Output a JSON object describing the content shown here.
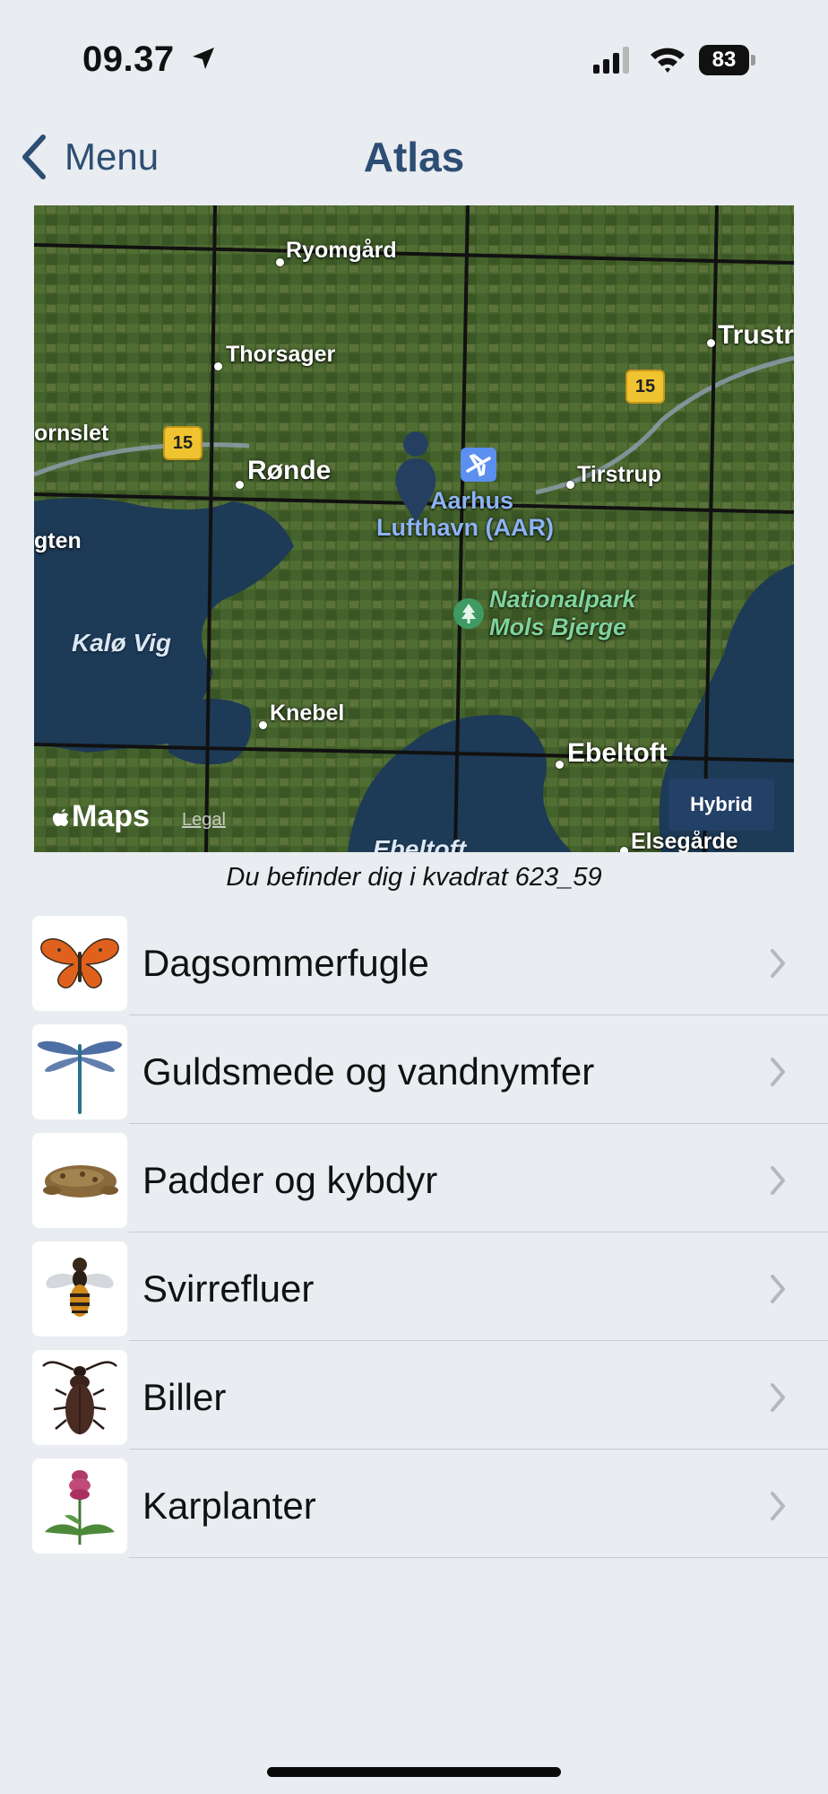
{
  "status": {
    "time": "09.37",
    "battery": "83"
  },
  "nav": {
    "back_label": "Menu",
    "title": "Atlas"
  },
  "map": {
    "type": "Hybrid",
    "labels": {
      "ryomgaard": "Ryomgård",
      "thorsager": "Thorsager",
      "trustrup": "Trustr",
      "hornslet": "ornslet",
      "ronde": "Rønde",
      "tirstrup": "Tirstrup",
      "airport_line1": "Aarhus",
      "airport_line2": "Lufthavn (AAR)",
      "egtved": "gten",
      "kalo_vig": "Kalø Vig",
      "park_line1": "Nationalpark",
      "park_line2": "Mols Bjerge",
      "knebel": "Knebel",
      "ebeltoft": "Ebeltoft",
      "ebeltoft_vig": "Ebeltoft",
      "elsegaarde": "Elsegårde",
      "route_a": "15",
      "route_b": "15"
    },
    "attribution": "Maps",
    "legal": "Legal",
    "hybrid_button": "Hybrid"
  },
  "location_caption": "Du befinder dig i kvadrat 623_59",
  "categories": [
    {
      "label": "Dagsommerfugle",
      "icon": "butterfly-icon"
    },
    {
      "label": "Guldsmede og vandnymfer",
      "icon": "dragonfly-icon"
    },
    {
      "label": "Padder og kybdyr",
      "icon": "toad-icon"
    },
    {
      "label": "Svirrefluer",
      "icon": "hoverfly-icon"
    },
    {
      "label": "Biller",
      "icon": "beetle-icon"
    },
    {
      "label": "Karplanter",
      "icon": "orchid-icon"
    }
  ]
}
